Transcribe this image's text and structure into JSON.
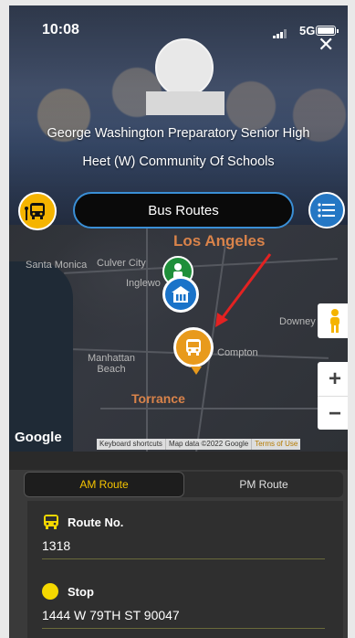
{
  "status_bar": {
    "time": "10:08",
    "network": "5G"
  },
  "header": {
    "close_label": "✕",
    "school_name": "George Washington Preparatory Senior High",
    "community": "Heet (W) Community Of Schools"
  },
  "controls": {
    "routes_title": "Bus Routes"
  },
  "map": {
    "labels": {
      "los_angeles": "Los Angeles",
      "santa_monica": "Santa Monica",
      "culver_city": "Culver City",
      "inglewood": "Inglewo",
      "downey": "Downey",
      "manhattan_beach": "Manhattan\nBeach",
      "compton": "Compton",
      "torrance": "Torrance"
    },
    "google": "Google",
    "footer": {
      "shortcuts": "Keyboard shortcuts",
      "mapdata": "Map data ©2022 Google",
      "terms": "Terms of Use"
    },
    "zoom_in": "+",
    "zoom_out": "−"
  },
  "route_panel": {
    "tabs": [
      {
        "label": "AM Route",
        "active": true
      },
      {
        "label": "PM Route",
        "active": false
      }
    ],
    "route_no_label": "Route No.",
    "route_no": "1318",
    "stop_label": "Stop",
    "stop": "1444 W 79TH ST 90047"
  },
  "colors": {
    "accent_yellow": "#f5c400",
    "bus_orange": "#e89a1c",
    "school_blue": "#1a73c9",
    "school_green": "#1f8f3a",
    "arrow_red": "#e32222"
  }
}
